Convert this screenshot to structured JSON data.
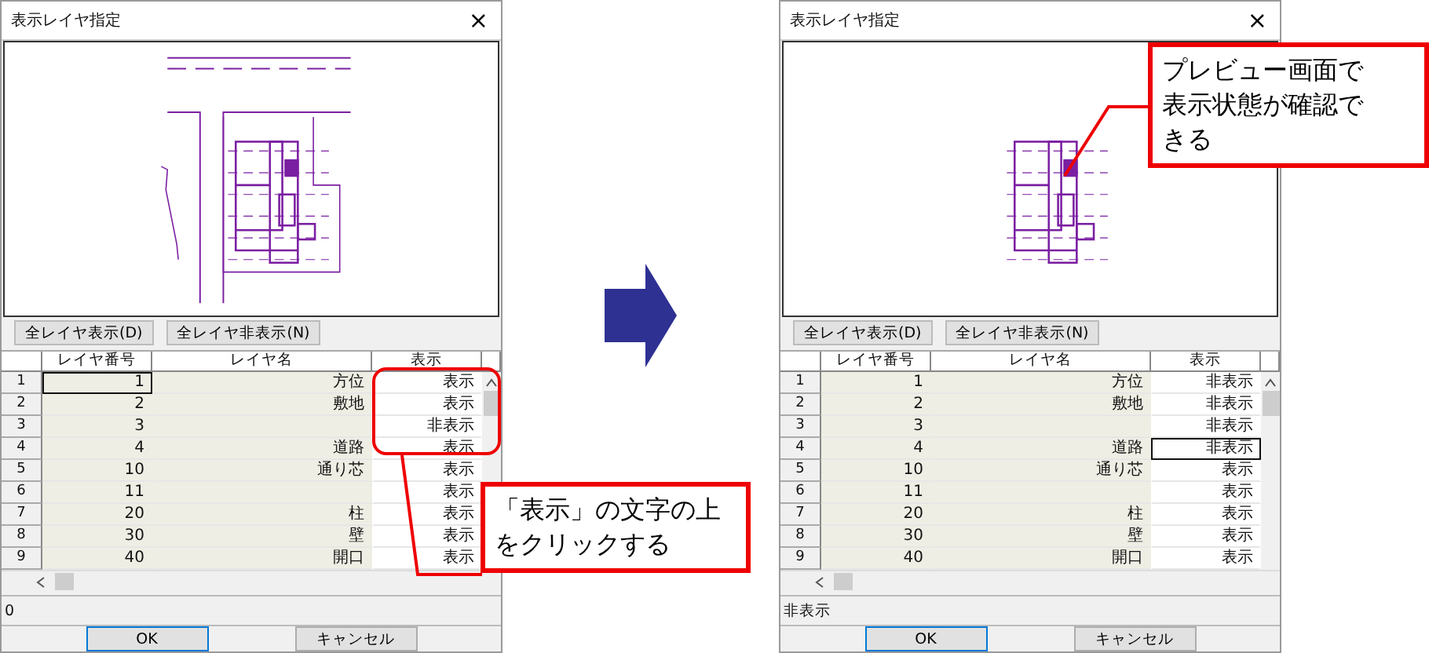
{
  "dialogs": [
    {
      "title": "表示レイヤ指定",
      "close": "×",
      "toolbar": [
        "全レイヤ表示(D)",
        "全レイヤ非表示(N)"
      ],
      "columns": [
        "レイヤ番号",
        "レイヤ名",
        "表示"
      ],
      "preview": {
        "north_arrow": true,
        "site": true,
        "roads": true
      },
      "rows": [
        {
          "index": "1",
          "number": "1",
          "name": "方位",
          "display": "表示",
          "number_focused": true,
          "display_focused": false
        },
        {
          "index": "2",
          "number": "2",
          "name": "敷地",
          "display": "表示",
          "number_focused": false,
          "display_focused": false
        },
        {
          "index": "3",
          "number": "3",
          "name": "",
          "display": "非表示",
          "number_focused": false,
          "display_focused": false
        },
        {
          "index": "4",
          "number": "4",
          "name": "道路",
          "display": "表示",
          "number_focused": false,
          "display_focused": false
        },
        {
          "index": "5",
          "number": "10",
          "name": "通り芯",
          "display": "表示",
          "number_focused": false,
          "display_focused": false
        },
        {
          "index": "6",
          "number": "11",
          "name": "",
          "display": "表示",
          "number_focused": false,
          "display_focused": false
        },
        {
          "index": "7",
          "number": "20",
          "name": "柱",
          "display": "表示",
          "number_focused": false,
          "display_focused": false
        },
        {
          "index": "8",
          "number": "30",
          "name": "壁",
          "display": "表示",
          "number_focused": false,
          "display_focused": false
        },
        {
          "index": "9",
          "number": "40",
          "name": "開口",
          "display": "表示",
          "number_focused": false,
          "display_focused": false
        }
      ],
      "status": "0",
      "ok": "OK",
      "cancel": "キャンセル"
    },
    {
      "title": "表示レイヤ指定",
      "close": "×",
      "toolbar": [
        "全レイヤ表示(D)",
        "全レイヤ非表示(N)"
      ],
      "columns": [
        "レイヤ番号",
        "レイヤ名",
        "表示"
      ],
      "preview": {
        "north_arrow": false,
        "site": false,
        "roads": false
      },
      "rows": [
        {
          "index": "1",
          "number": "1",
          "name": "方位",
          "display": "非表示",
          "number_focused": false,
          "display_focused": false
        },
        {
          "index": "2",
          "number": "2",
          "name": "敷地",
          "display": "非表示",
          "number_focused": false,
          "display_focused": false
        },
        {
          "index": "3",
          "number": "3",
          "name": "",
          "display": "非表示",
          "number_focused": false,
          "display_focused": false
        },
        {
          "index": "4",
          "number": "4",
          "name": "道路",
          "display": "非表示",
          "number_focused": false,
          "display_focused": true
        },
        {
          "index": "5",
          "number": "10",
          "name": "通り芯",
          "display": "表示",
          "number_focused": false,
          "display_focused": false
        },
        {
          "index": "6",
          "number": "11",
          "name": "",
          "display": "表示",
          "number_focused": false,
          "display_focused": false
        },
        {
          "index": "7",
          "number": "20",
          "name": "柱",
          "display": "表示",
          "number_focused": false,
          "display_focused": false
        },
        {
          "index": "8",
          "number": "30",
          "name": "壁",
          "display": "表示",
          "number_focused": false,
          "display_focused": false
        },
        {
          "index": "9",
          "number": "40",
          "name": "開口",
          "display": "表示",
          "number_focused": false,
          "display_focused": false
        }
      ],
      "status": "非表示",
      "ok": "OK",
      "cancel": "キャンセル"
    }
  ],
  "callouts": [
    {
      "lines": [
        "「表示」の文字の上",
        "をクリックする"
      ]
    },
    {
      "lines": [
        "プレビュー画面で",
        "表示状態が確認で",
        "きる"
      ]
    }
  ]
}
